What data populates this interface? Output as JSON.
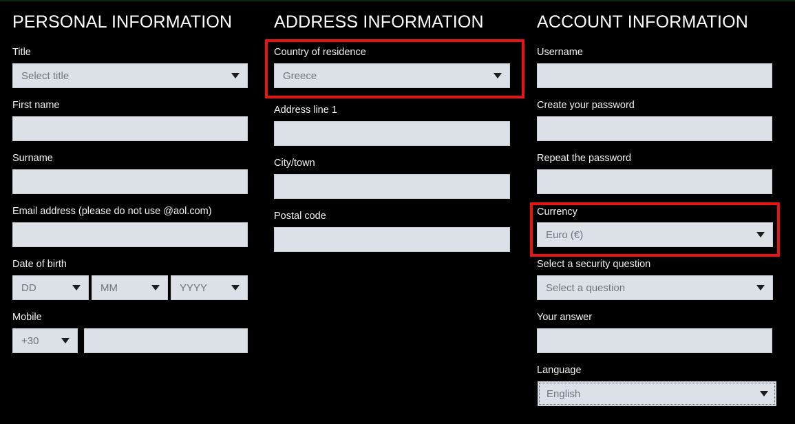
{
  "page": {
    "background_color": "#000000",
    "field_fill_color": "#dce0e7",
    "highlight_color": "#e81414",
    "top_strip_color": "#0c2410"
  },
  "sections": {
    "personal": {
      "title": "PERSONAL INFORMATION",
      "fields": {
        "title_label": "Title",
        "title_value": "Select title",
        "first_name_label": "First name",
        "first_name_value": "",
        "surname_label": "Surname",
        "surname_value": "",
        "email_label": "Email address (please do not use @aol.com)",
        "email_value": "",
        "dob_label": "Date of birth",
        "dob_day_value": "DD",
        "dob_month_value": "MM",
        "dob_year_value": "YYYY",
        "mobile_label": "Mobile",
        "mobile_code_value": "+30",
        "mobile_number_value": ""
      }
    },
    "address": {
      "title": "ADDRESS INFORMATION",
      "fields": {
        "country_label": "Country of residence",
        "country_value": "Greece",
        "address1_label": "Address line 1",
        "address1_value": "",
        "city_label": "City/town",
        "city_value": "",
        "postal_label": "Postal code",
        "postal_value": ""
      }
    },
    "account": {
      "title": "ACCOUNT INFORMATION",
      "fields": {
        "username_label": "Username",
        "username_value": "",
        "password_label": "Create your password",
        "password_value": "",
        "repeat_password_label": "Repeat the password",
        "repeat_password_value": "",
        "currency_label": "Currency",
        "currency_value": "Euro (€)",
        "security_question_label": "Select a security question",
        "security_question_value": "Select a question",
        "answer_label": "Your answer",
        "answer_value": "",
        "language_label": "Language",
        "language_value": "English"
      }
    }
  },
  "icons": {
    "caret": "chevron-down-icon"
  }
}
